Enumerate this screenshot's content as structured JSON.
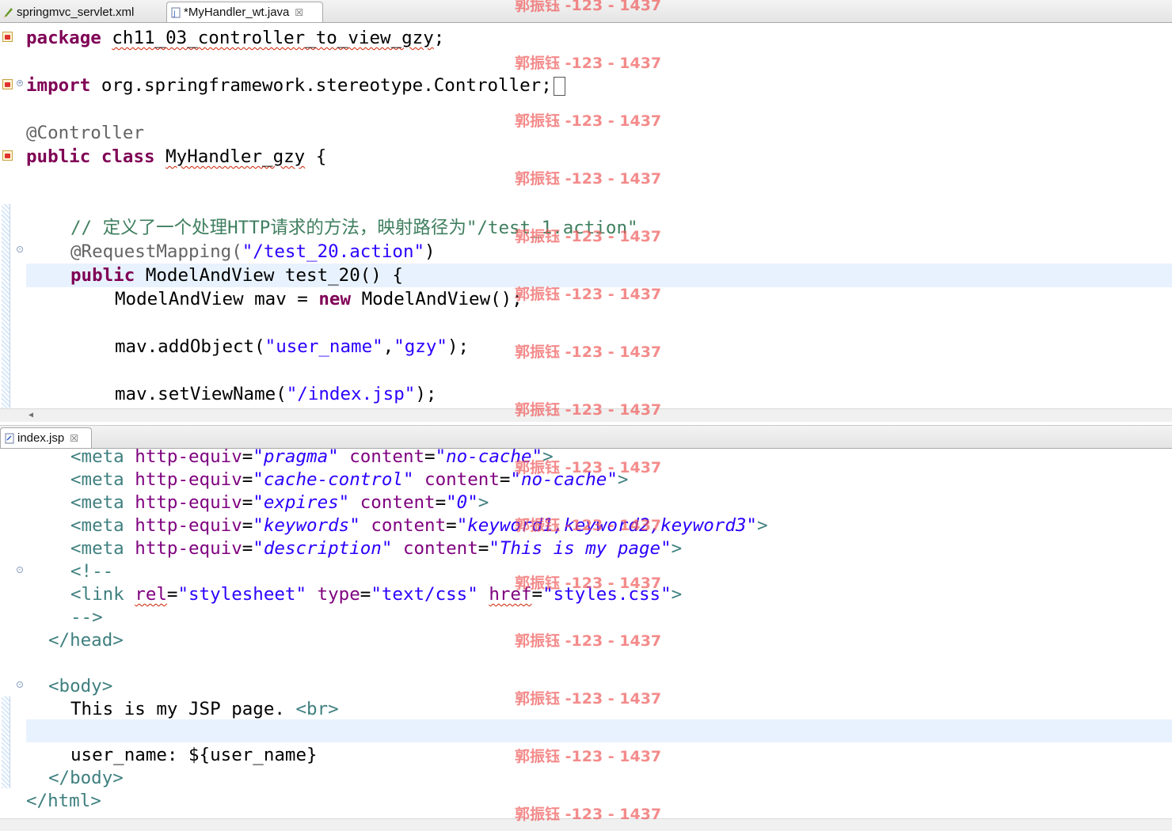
{
  "tabs_top": [
    {
      "label": "springmvc_servlet.xml",
      "icon": "xml-file-icon",
      "active": false
    },
    {
      "label": "*MyHandler_wt.java",
      "icon": "java-file-icon",
      "active": true,
      "close": "☒"
    }
  ],
  "tabs_bottom": [
    {
      "label": "index.jsp",
      "icon": "jsp-file-icon",
      "active": true,
      "close": "☒"
    }
  ],
  "java_lines": {
    "l1_kw": "package",
    "l1_pkg": "ch11_03_controller_to_view_gzy",
    "l1_end": ";",
    "l3_kw": "import",
    "l3_rest": " org.springframework.stereotype.Controller;",
    "l5": "@Controller",
    "l6_kw1": "public",
    "l6_kw2": "class",
    "l6_name": "MyHandler_gzy",
    "l6_end": " {",
    "l9_comment": "// 定义了一个处理HTTP请求的方法，映射路径为\"/test_1.action\"",
    "l10_ann": "@RequestMapping(",
    "l10_str": "\"/test_20.action\"",
    "l10_end": ")",
    "l11_kw": "public",
    "l11_rest": " ModelAndView test_20() {",
    "l12_a": "ModelAndView mav = ",
    "l12_kw": "new",
    "l12_b": " ModelAndView();",
    "l14_a": "mav.addObject(",
    "l14_s1": "\"user_name\"",
    "l14_c": ",",
    "l14_s2": "\"gzy\"",
    "l14_e": ");",
    "l16_a": "mav.setViewName(",
    "l16_s": "\"/index.jsp\"",
    "l16_e": ");"
  },
  "jsp_meta": [
    {
      "equiv": "\"pragma\"",
      "content": "\"no-cache\""
    },
    {
      "equiv": "\"cache-control\"",
      "content": "\"no-cache\""
    },
    {
      "equiv": "\"expires\"",
      "content": "\"0\""
    },
    {
      "equiv": "\"keywords\"",
      "content": "\"keyword1,keyword2,keyword3\""
    },
    {
      "equiv": "\"description\"",
      "content": "\"This is my page\""
    }
  ],
  "jsp_lines": {
    "meta_open": "<meta ",
    "meta_attr1": "http-equiv",
    "eq": "=",
    "meta_attr2": "content",
    "meta_close": ">",
    "comment_open": "<!--",
    "link_open": "<link ",
    "link_rel": "rel",
    "link_rel_val": "\"stylesheet\"",
    "link_type": "type",
    "link_type_val": "\"text/css\"",
    "link_href": "href",
    "link_href_val": "\"styles.css\"",
    "link_close": ">",
    "comment_close": "-->",
    "head_close": "</head>",
    "body_open": "<body>",
    "body_text": "This is my JSP page. ",
    "br": "<br>",
    "user_line": "user_name: ${user_name}",
    "body_close": "</body>",
    "html_close": "</html>"
  },
  "watermark": "郭振钰 -123 - 1437"
}
